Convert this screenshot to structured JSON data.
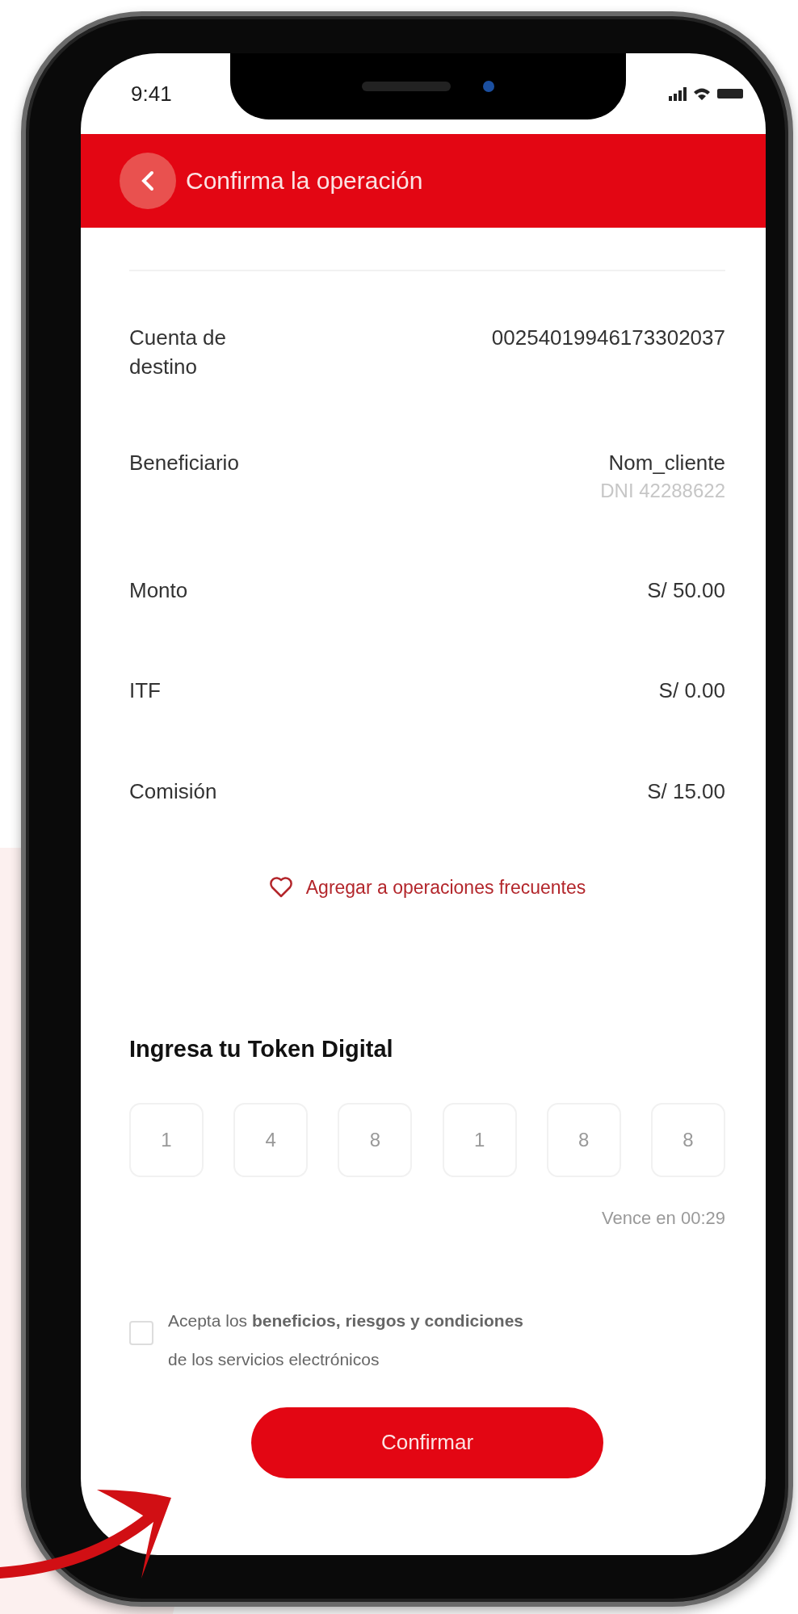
{
  "status_bar": {
    "time": "9:41"
  },
  "header": {
    "title": "Confirma la operación"
  },
  "details": [
    {
      "label": "Cuenta de destino",
      "value": "00254019946173302037"
    },
    {
      "label": "Beneficiario",
      "value": "Nom_cliente",
      "subvalue": "DNI 42288622"
    },
    {
      "label": "Monto",
      "value": "S/ 50.00"
    },
    {
      "label": "ITF",
      "value": "S/ 0.00"
    },
    {
      "label": "Comisión",
      "value": "S/ 15.00"
    }
  ],
  "favorite_link": {
    "label": "Agregar a operaciones frecuentes"
  },
  "token": {
    "title": "Ingresa tu Token Digital",
    "digits": [
      "1",
      "4",
      "8",
      "1",
      "8",
      "8"
    ],
    "expiry": "Vence en 00:29"
  },
  "terms": {
    "checked": false,
    "text": "Acepta los **beneficios, riesgos y condiciones** de los servicios electrónicos"
  },
  "confirm_button": {
    "label": "Confirmar"
  }
}
